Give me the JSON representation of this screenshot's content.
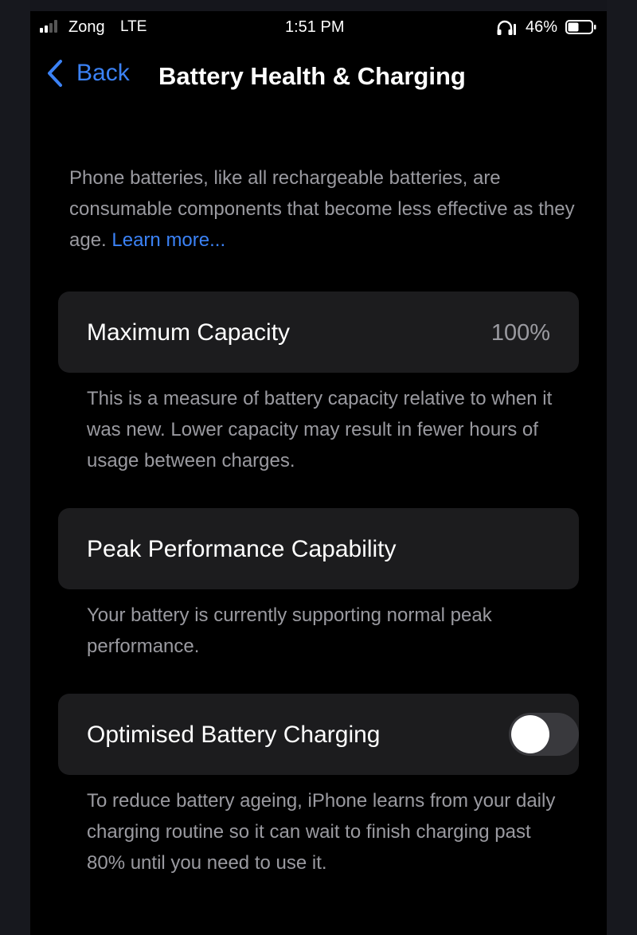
{
  "status_bar": {
    "carrier": "Zong",
    "network": "LTE",
    "time": "1:51 PM",
    "battery_percent": "46%",
    "signal_bars": 2,
    "icons": [
      "signal-icon",
      "headphone-icon",
      "battery-icon"
    ]
  },
  "nav": {
    "back_label": "Back",
    "title": "Battery Health & Charging"
  },
  "intro": {
    "text": "Phone batteries, like all rechargeable batteries, are consumable components that become less effective as they age. ",
    "link": "Learn more..."
  },
  "sections": {
    "max_capacity": {
      "label": "Maximum Capacity",
      "value": "100%",
      "description": "This is a measure of battery capacity relative to when it was new. Lower capacity may result in fewer hours of usage between charges."
    },
    "peak_performance": {
      "label": "Peak Performance Capability",
      "description": "Your battery is currently supporting normal peak performance."
    },
    "optimised_charging": {
      "label": "Optimised Battery Charging",
      "enabled": false,
      "description": "To reduce battery ageing, iPhone learns from your daily charging routine so it can wait to finish charging past 80% until you need to use it."
    }
  },
  "colors": {
    "accent": "#3b82f6",
    "background": "#000000",
    "card": "#1c1c1e",
    "secondary_text": "#9a9aa0",
    "toggle_off": "#39393d"
  }
}
